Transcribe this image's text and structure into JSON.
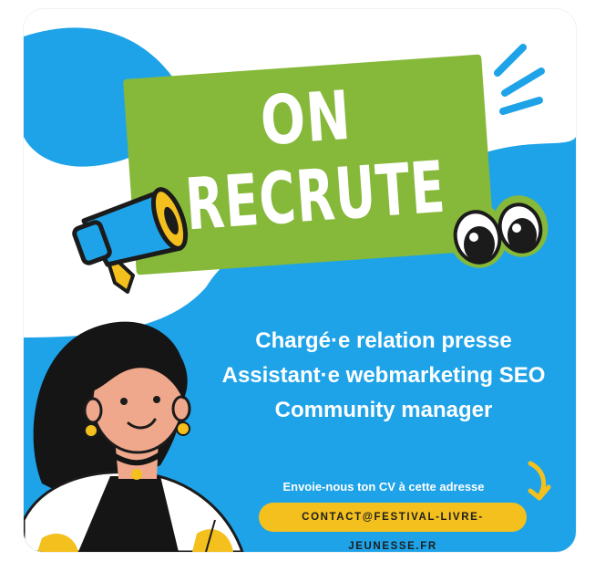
{
  "headline": {
    "line1": "ON",
    "line2": "RECRUTE"
  },
  "jobs": [
    "Chargé·e relation presse",
    "Assistant·e webmarketing SEO",
    "Community manager"
  ],
  "cta": {
    "text": "Envoie-nous ton CV à cette adresse",
    "email": "CONTACT@FESTIVAL-LIVRE-JEUNESSE.FR"
  },
  "colors": {
    "blue": "#1ea3e8",
    "green": "#86b83a",
    "yellow": "#f4c01e",
    "white": "#ffffff"
  },
  "icons": [
    "megaphone-icon",
    "eyes-icon",
    "sparkle-lines-icon",
    "arrow-down-icon",
    "woman-illustration"
  ]
}
